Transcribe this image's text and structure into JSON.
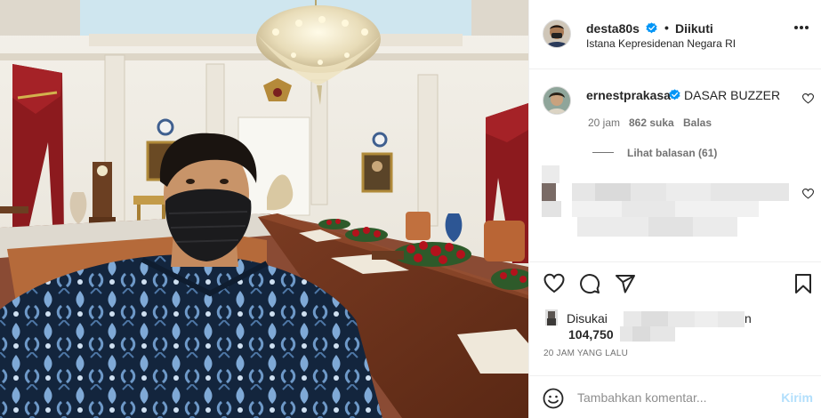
{
  "post": {
    "author": {
      "username": "desta80s",
      "verified": true,
      "follow_status": "Diikuti",
      "separator": "•",
      "location": "Istana Kepresidenan Negara RI"
    },
    "photo": {
      "icon": "post-photo"
    },
    "more_icon": "more-horizontal-icon"
  },
  "comments": [
    {
      "username": "ernestprakasa",
      "verified": true,
      "text": "DASAR BUZZER",
      "time": "20 jam",
      "likes": "862 suka",
      "reply_label": "Balas",
      "view_replies": "Lihat balasan (61)"
    }
  ],
  "actions": {
    "like_icon": "heart-icon",
    "comment_icon": "comment-icon",
    "share_icon": "share-icon",
    "save_icon": "bookmark-icon"
  },
  "likes": {
    "prefix": "Disukai",
    "suffix": "n",
    "count": "104,750"
  },
  "timestamp": "20 JAM YANG LALU",
  "composer": {
    "placeholder": "Tambahkan komentar...",
    "send_label": "Kirim",
    "send_color": "#b2dffc"
  },
  "colors": {
    "verified_blue": "#0095f6",
    "muted_text": "#737373"
  }
}
